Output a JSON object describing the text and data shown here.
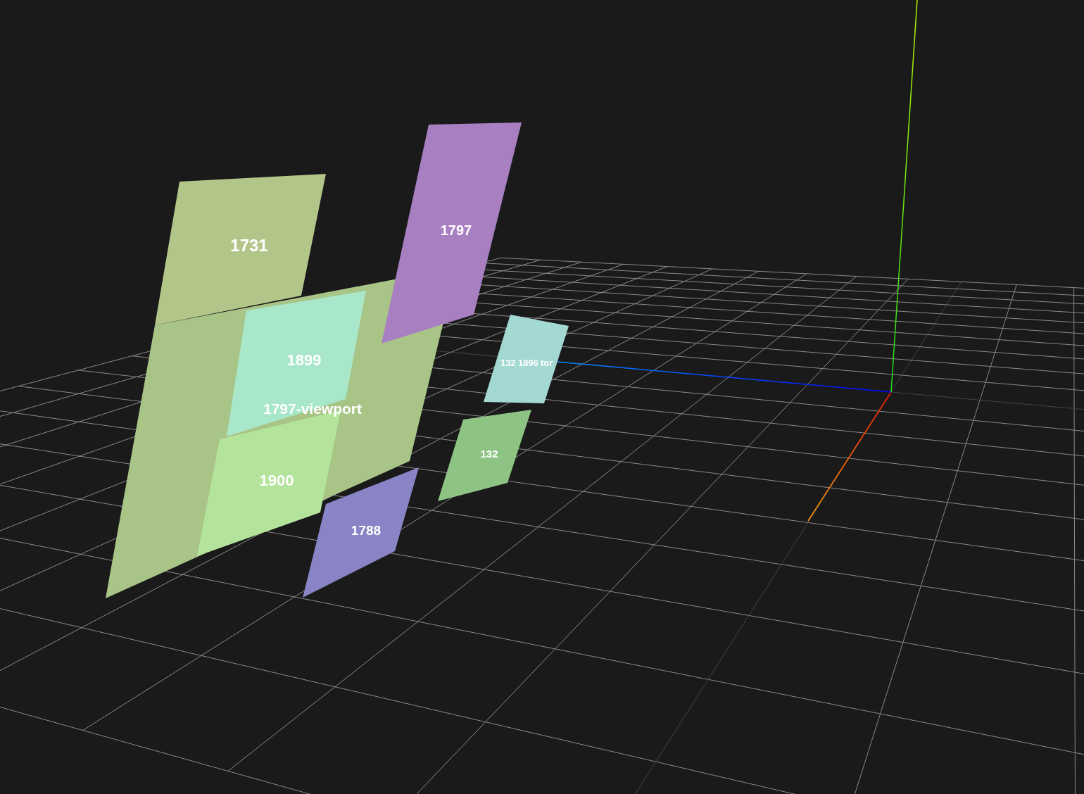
{
  "scene": {
    "layers": [
      {
        "labels": [
          "1731"
        ],
        "color": "#b3c68a"
      },
      {
        "labels": [
          "1797-viewport"
        ],
        "color": "#a8c487"
      },
      {
        "labels": [
          "1899"
        ],
        "color": "#a8e7c9"
      },
      {
        "labels": [
          "1900"
        ],
        "color": "#b4e49c"
      },
      {
        "labels": [
          "1797"
        ],
        "color": "#a880c2"
      },
      {
        "labels": [
          "1788"
        ],
        "color": "#8884c6"
      },
      {
        "labels": [
          "132"
        ],
        "color": "#8dc484"
      },
      {
        "labels": [
          "132",
          "1896",
          "tor"
        ],
        "color": "#a4d8d2"
      }
    ]
  }
}
